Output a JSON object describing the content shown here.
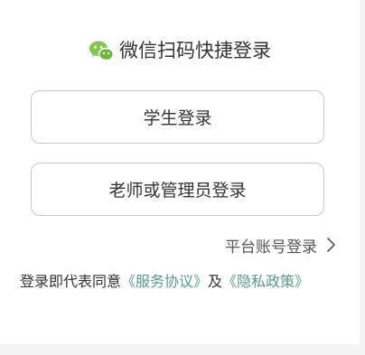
{
  "title": {
    "icon": "wechat-icon",
    "text": "微信扫码快捷登录"
  },
  "buttons": {
    "student": "学生登录",
    "teacher": "老师或管理员登录"
  },
  "platform_login": {
    "label": "平台账号登录",
    "icon": "chevron-right-icon"
  },
  "agreement": {
    "prefix": "登录即代表同意",
    "service": "《服务协议》",
    "conjunction": "及",
    "privacy": "《隐私政策》"
  },
  "colors": {
    "text": "#333333",
    "muted": "#555555",
    "link": "#5b9a84",
    "border": "#c9c9c9",
    "wechat_main": "#86c456",
    "wechat_second": "#6cb83e",
    "background": "#f4f4f4"
  }
}
